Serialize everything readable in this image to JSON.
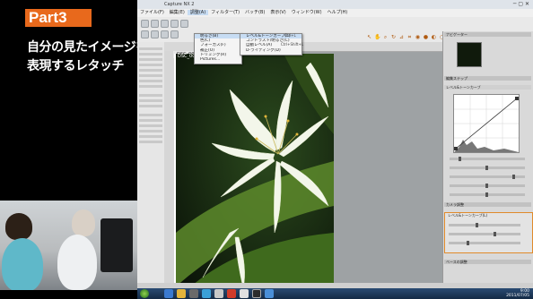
{
  "overlay": {
    "part_label": "Part3",
    "line1": "自分の見たイメージを",
    "line2": "表現するレタッチ"
  },
  "app": {
    "title": "Capture NX 2",
    "doc_tab": "DSC_0048.NEF",
    "image_label": "DSC_0048",
    "win_buttons": "─ ▢ ✕",
    "menus": [
      "ファイル(F)",
      "編集(E)",
      "調整(A)",
      "フィルター(T)",
      "バッチ(B)",
      "表示(V)",
      "ウィンドウ(W)",
      "ヘルプ(H)"
    ],
    "menu_active": "調整(A)"
  },
  "dropdown": {
    "items": [
      "明るさ(B)",
      "色(C)",
      "フォーカス(F)",
      "補正(O)",
      "トリミング(R)",
      "Pictures…"
    ],
    "submenu_items": [
      "レベル&トーンカーブ(L)",
      "コントラスト/明るさ(C)",
      "自動レベル(A)",
      "D-ライティング(D)"
    ],
    "submenu_shortcuts": [
      "Ctrl+L",
      "",
      "Ctrl+Shift+L",
      ""
    ]
  },
  "right_panel": {
    "sections": [
      "ナビゲーター",
      "編集ステップ",
      "レベル&トーンカーブ",
      "カメラ調整",
      "ベースの調整"
    ],
    "highlighted_step": "レベル&トーンカーブ(L)"
  },
  "taskbar": {
    "time": "9:00",
    "date": "2011/07/05"
  },
  "colors": {
    "accent_orange": "#e8691c",
    "taskbar": "#1d3656",
    "menu_highlight": "#c7dcf3"
  }
}
